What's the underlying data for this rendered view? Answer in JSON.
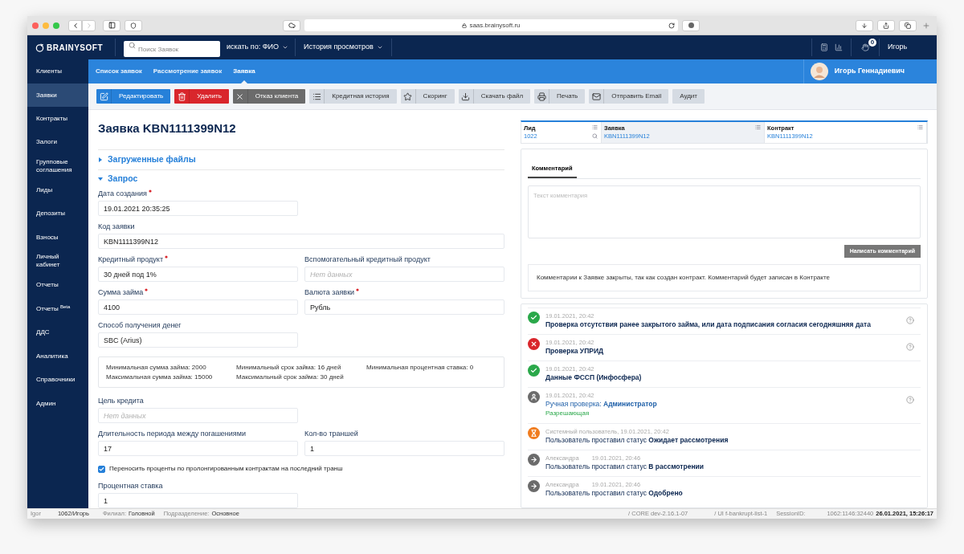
{
  "browser": {
    "url": "saas.brainysoft.ru"
  },
  "header": {
    "logo": "BRAINYSOFT",
    "search": {
      "placeholder": "Поиск Заявок"
    },
    "search_by": "искать по: ФИО",
    "history": "История просмотров",
    "badge": "0",
    "user": "Игорь"
  },
  "sidebar": {
    "items": [
      {
        "label": "Клиенты",
        "selected": false
      },
      {
        "label": "Заявки",
        "selected": true
      },
      {
        "label": "Контракты",
        "selected": false
      },
      {
        "label": "Залоги",
        "selected": false
      },
      {
        "label": "Групповые соглашения",
        "selected": false
      },
      {
        "label": "Лиды",
        "selected": false
      },
      {
        "label": "Депозиты",
        "selected": false
      },
      {
        "label": "Взносы",
        "selected": false
      },
      {
        "label": "Личный кабинет",
        "selected": false
      },
      {
        "label": "Отчеты",
        "selected": false
      },
      {
        "label": "Отчеты $^{Beta}$",
        "selected": false
      },
      {
        "label": "ДДС",
        "selected": false
      },
      {
        "label": "Аналитика",
        "selected": false
      },
      {
        "label": "Справочники",
        "selected": false
      },
      {
        "label": "Админ",
        "selected": false
      }
    ]
  },
  "subnav": {
    "tabs": [
      {
        "label": "Список заявок",
        "selected": false
      },
      {
        "label": "Рассмотрение заявок",
        "selected": false
      },
      {
        "label": "Заявка",
        "selected": true
      }
    ],
    "profile": "Игорь Геннадиевич"
  },
  "toolbar": [
    {
      "label": "Редактировать",
      "kind": "primary"
    },
    {
      "label": "Удалить",
      "kind": "danger"
    },
    {
      "label": "Отказ клиента",
      "kind": "dark"
    },
    {
      "label": "Кредитная история",
      "kind": "light"
    },
    {
      "label": "Скоринг",
      "kind": "light"
    },
    {
      "label": "Скачать файл",
      "kind": "light"
    },
    {
      "label": "Печать",
      "kind": "light"
    },
    {
      "label": "Отправить Email",
      "kind": "light"
    },
    {
      "label": "Аудит",
      "kind": "light"
    }
  ],
  "title": "Заявка KBN1111399N12",
  "sections": [
    {
      "title": "Загруженные файлы",
      "expanded": false
    },
    {
      "title": "Запрос",
      "expanded": true
    }
  ],
  "form_rows": [
    {
      "wide": false,
      "fields": [
        {
          "label": "Дата создания",
          "required": true,
          "value": "19.01.2021 20:35:25"
        }
      ]
    },
    {
      "wide": true,
      "fields": [
        {
          "label": "Код заявки",
          "required": false,
          "value": "KBN1111399N12"
        }
      ]
    },
    {
      "wide": false,
      "fields": [
        {
          "label": "Кредитный продукт",
          "required": true,
          "value": "30 дней под 1%"
        },
        {
          "label": "Вспомогательный кредитный продукт",
          "required": false,
          "placeholder": "Нет данных"
        }
      ]
    },
    {
      "wide": false,
      "fields": [
        {
          "label": "Сумма займа",
          "required": true,
          "value": "4100"
        },
        {
          "label": "Валюта заявки",
          "required": true,
          "value": "Рубль"
        }
      ]
    },
    {
      "wide": false,
      "fields": [
        {
          "label": "Способ получения денег",
          "required": false,
          "value": "SBC (Arius)"
        }
      ]
    }
  ],
  "limits": [
    "Минимальная сумма займа: 2000",
    "Минимальный срок займа: 16 дней",
    "Минимальная процентная ставка: 0",
    "Максимальная сумма займа: 15000",
    "Максимальный срок займа: 30 дней"
  ],
  "form_rows_2": [
    {
      "wide": false,
      "fields": [
        {
          "label": "Цель кредита",
          "required": false,
          "placeholder": "Нет данных"
        }
      ]
    },
    {
      "wide": false,
      "fields": [
        {
          "label": "Длительность периода между погашениями",
          "required": false,
          "value": "17"
        },
        {
          "label": "Кол-во траншей",
          "required": false,
          "value": "1"
        }
      ]
    }
  ],
  "checkbox": {
    "label": "Переносить проценты по пролонгированным контрактам на последний транш",
    "checked": true
  },
  "form_rows_3": [
    {
      "wide": false,
      "fields": [
        {
          "label": "Процентная ставка",
          "required": false,
          "value": "1"
        }
      ]
    }
  ],
  "links": [
    {
      "label": "Лид",
      "value": "1022",
      "selected": false,
      "search": true
    },
    {
      "label": "Заявка",
      "value": "KBN1111399N12",
      "selected": true,
      "search": false
    },
    {
      "label": "Контракт",
      "value": "KBN1111399N12",
      "selected": false,
      "search": false
    }
  ],
  "comments": {
    "tab": "Комментарий",
    "placeholder": "Текст комментария",
    "button": "Написать комментарий",
    "notice": "Комментарии к Заявке закрыты, так как создан контракт. Комментарий будет записан в Контракте"
  },
  "timeline": [
    {
      "kind": "success",
      "meta": "19.01.2021, 20:42",
      "title": "**Проверка отсутствия ранее закрытого займа, или дата подписания согласия сегодняшняя дата**",
      "help": true
    },
    {
      "kind": "fail",
      "meta": "19.01.2021, 20:42",
      "title": "**Проверка УПРИД**",
      "help": true
    },
    {
      "kind": "success",
      "meta": "19.01.2021, 20:42",
      "title": "**Данные ФССП (Инфосфера)**",
      "help": false
    },
    {
      "kind": "manual",
      "meta": "19.01.2021, 20:42",
      "title": "Ручная проверка: **Администратор**",
      "result": "Разрешающая",
      "help": true
    },
    {
      "kind": "waiting",
      "meta": "Системный пользователь, 19.01.2021, 20:42",
      "title": "Пользователь проставил статус **Ожидает рассмотрения**",
      "help": false
    },
    {
      "kind": "status",
      "meta": "Александра",
      "meta2": "19.01.2021, 20:46",
      "title": "Пользователь проставил статус **В рассмотрении**",
      "help": false
    },
    {
      "kind": "status",
      "meta": "Александра",
      "meta2": "19.01.2021, 20:46",
      "title": "Пользователь проставил статус **Одобрено**",
      "help": false
    }
  ],
  "status_bar": {
    "login": "Igor",
    "user": "1062/Игорь",
    "branch_label": "Филиал:",
    "branch": "Головной",
    "division_label": "Подразделение:",
    "division": "Основное",
    "core": "/ CORE dev-2.16.1-07",
    "ui": "/ UI f-bankrupt-list-1",
    "session_label": "SessionID:",
    "session": "1062:1146:32440",
    "datetime": "26.01.2021, 15:26:17"
  }
}
